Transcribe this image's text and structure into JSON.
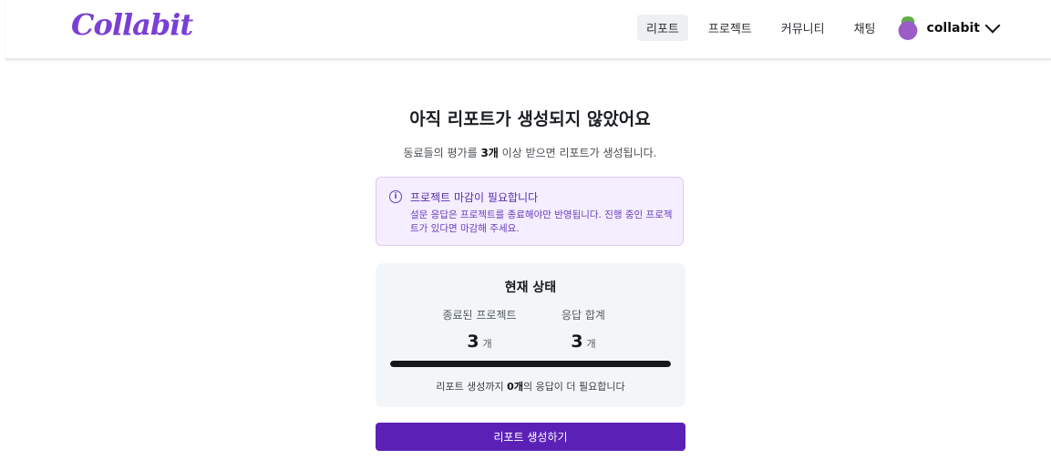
{
  "header": {
    "logo_text": "Collabit",
    "nav": [
      {
        "label": "리포트",
        "active": true
      },
      {
        "label": "프로젝트",
        "active": false
      },
      {
        "label": "커뮤니티",
        "active": false
      },
      {
        "label": "채팅",
        "active": false
      }
    ],
    "profile_name": "collabit"
  },
  "main": {
    "title": "아직 리포트가 생성되지 않았어요",
    "subtitle_prefix": "동료들의 평가를 ",
    "subtitle_count": "3개",
    "subtitle_suffix": " 이상 받으면 리포트가 생성됩니다."
  },
  "notice": {
    "icon": "info-icon",
    "title": "프로젝트 마감이 필요합니다",
    "body": "설문 응답은 프로젝트를 종료해야만 반영됩니다. 진행 중인 프로젝트가 있다면 마감해 주세요."
  },
  "status": {
    "title": "현재 상태",
    "completed_label": "종료된 프로젝트",
    "completed_value": "3",
    "responses_label": "응답 합계",
    "responses_value": "3",
    "unit": "개",
    "progress_fraction": 1.0,
    "footer_prefix": "리포트 생성까지 ",
    "footer_count": "0개",
    "footer_suffix": "의 응답이 더 필요합니다"
  },
  "cta": {
    "label": "리포트 생성하기"
  },
  "colors": {
    "accent": "#5b21b6",
    "notice_bg": "#f4eefe",
    "notice_text": "#6b3cc2"
  }
}
